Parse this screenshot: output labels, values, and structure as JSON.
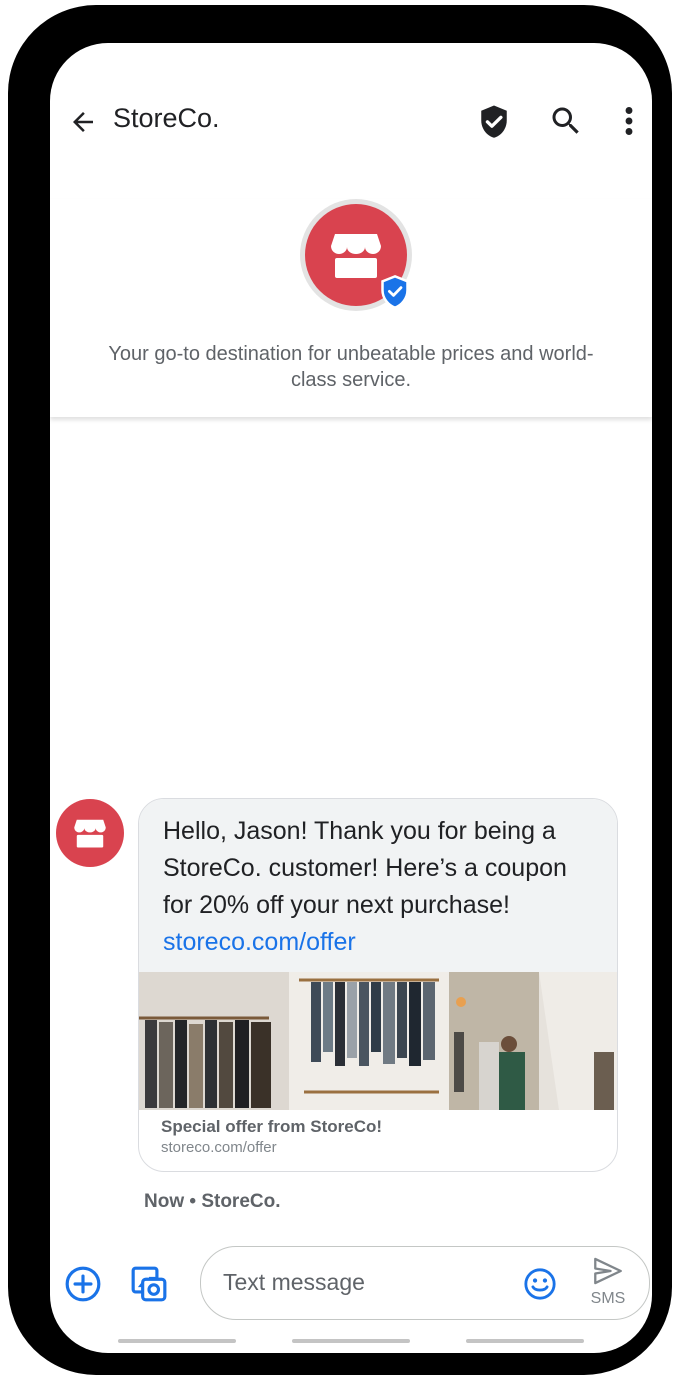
{
  "appbar": {
    "title": "StoreCo.",
    "back_icon": "arrow-back-icon",
    "shield_icon": "verified-shield-icon",
    "search_icon": "search-icon",
    "more_icon": "more-vert-icon"
  },
  "business": {
    "logo_icon": "storefront-icon",
    "badge_icon": "verified-badge-icon",
    "tagline": "Your go-to destination for unbeatable prices and world-class service."
  },
  "message": {
    "text": "Hello, Jason! Thank you for being a StoreCo. customer! Here’s a coupon for 20% off your next purchase!",
    "link": "storeco.com/offer",
    "card_title": "Special offer from StoreCo!",
    "card_url": "storeco.com/offer",
    "timestamp": "Now • StoreCo."
  },
  "composer": {
    "placeholder": "Text message",
    "send_label": "SMS",
    "add_icon": "add-circle-icon",
    "gallery_icon": "gallery-icon",
    "emoji_icon": "emoji-icon",
    "send_icon": "send-icon"
  },
  "colors": {
    "brand": "#d9434f",
    "accent": "#1a73e8",
    "bubble": "#f1f3f4"
  }
}
